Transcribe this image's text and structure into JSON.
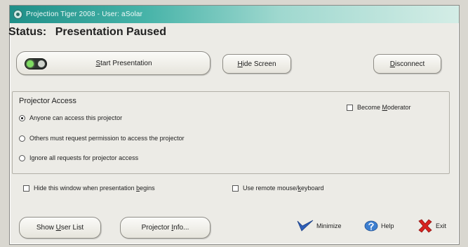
{
  "window": {
    "title": "Projection Tiger 2008 - User: aSolar"
  },
  "status": {
    "label": "Status:",
    "value": "Presentation Paused"
  },
  "buttons": {
    "start": {
      "prefix": "",
      "accel": "S",
      "rest": "tart Presentation"
    },
    "hide": {
      "accel": "H",
      "rest": "ide Screen"
    },
    "disconnect": {
      "prefix": "",
      "accel": "D",
      "rest": "isconnect"
    }
  },
  "projector_access": {
    "title": "Projector Access",
    "options": [
      {
        "label": "Anyone can access this projector",
        "selected": true
      },
      {
        "label": "Others must request permission to access the projector",
        "selected": false
      },
      {
        "label": "Ignore all requests for projector access",
        "selected": false
      }
    ],
    "become_moderator": {
      "prefix": "Become ",
      "accel": "M",
      "rest": "oderator",
      "checked": false
    }
  },
  "options": {
    "hide_window": {
      "prefix": "Hide this window when presentation ",
      "accel": "b",
      "rest": "egins",
      "checked": false
    },
    "remote_mouse": {
      "prefix": "Use remote mouse/",
      "accel": "k",
      "rest": "eyboard",
      "checked": false
    }
  },
  "footer": {
    "user_list": {
      "prefix": "Show ",
      "accel": "U",
      "rest": "ser List"
    },
    "projector_info": {
      "prefix": "Projector ",
      "accel": "I",
      "rest": "nfo..."
    },
    "minimize": "Minimize",
    "help": "Help",
    "exit": "Exit"
  },
  "colors": {
    "titlebar_start": "#1f8f88",
    "toggle_on": "#7fdc62",
    "minimize_icon": "#2f5fb8",
    "help_icon": "#3d7fd0",
    "exit_icon": "#d8231f"
  },
  "icons": {
    "app": "app-icon",
    "toggle": "toggle-switch-icon",
    "minimize": "checkmark-arrow-icon",
    "help": "help-icon",
    "exit": "red-x-icon"
  }
}
